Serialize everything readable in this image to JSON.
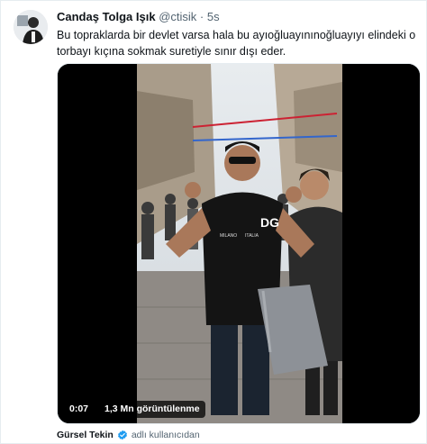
{
  "tweet": {
    "author_name": "Candaş Tolga Işık",
    "handle": "@ctisik",
    "separator": "·",
    "time": "5s",
    "text": "Bu topraklarda bir devlet varsa hala bu ayıoğluayınınoğluayıyı elindeki o torbayı kıçına sokmak suretiyle sınır dışı eder."
  },
  "video": {
    "duration": "0:07",
    "views": "1,3 Mn görüntülenme",
    "shirt_text_1": "DG",
    "shirt_text_2": "MILANO",
    "shirt_text_3": "ITALIA"
  },
  "footer": {
    "name": "Gürsel Tekin",
    "note": "adlı kullanıcıdan",
    "verified_color": "#1d9bf0"
  },
  "colors": {
    "name": "#0f1419",
    "muted": "#536471",
    "accent": "#1d9bf0"
  }
}
